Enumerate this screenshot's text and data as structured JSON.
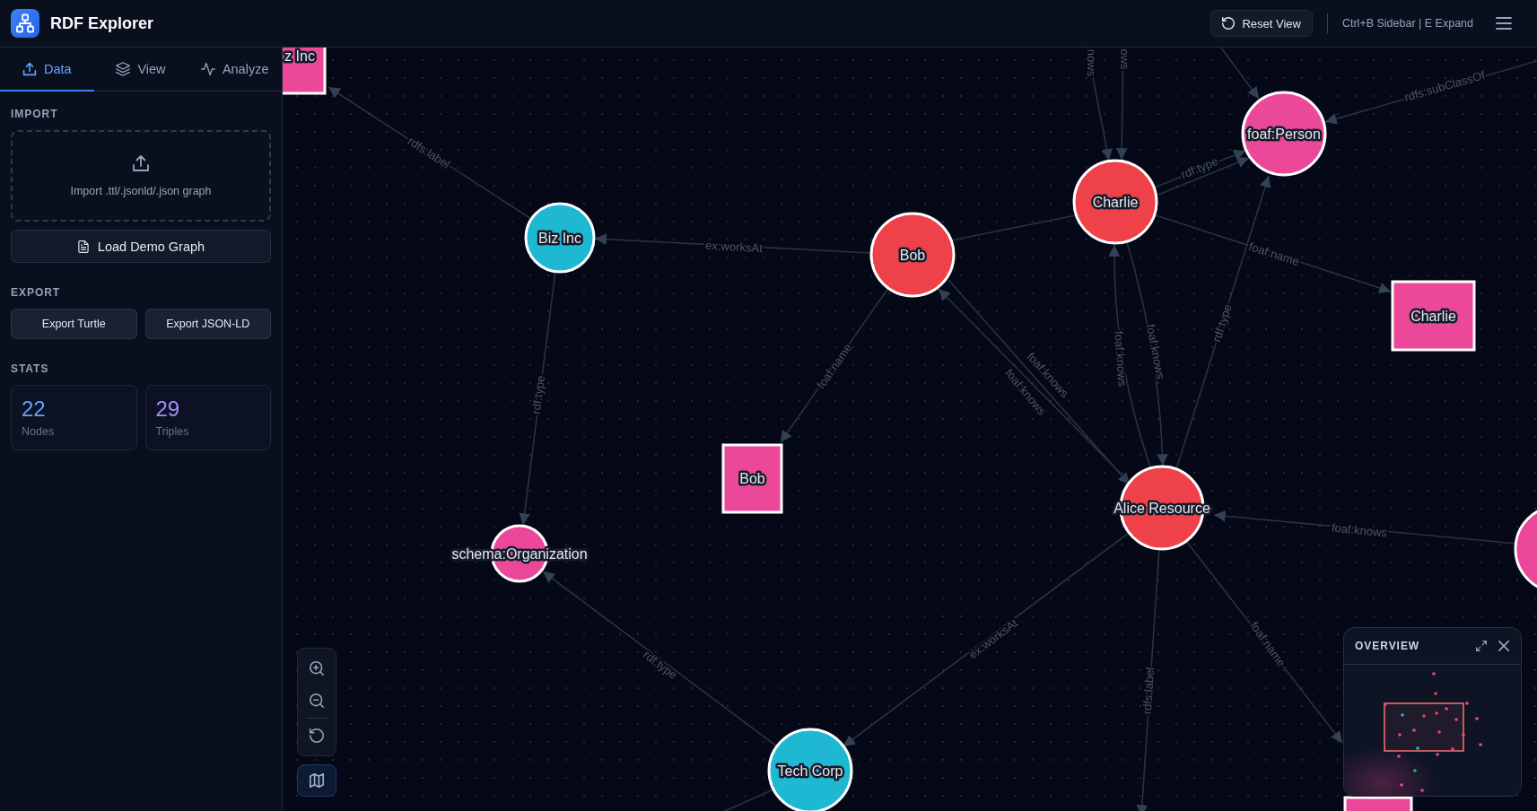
{
  "header": {
    "title": "RDF Explorer",
    "reset_button": "Reset View",
    "shortcut_hint": "Ctrl+B Sidebar | E Expand"
  },
  "sidebar": {
    "tabs": [
      {
        "label": "Data",
        "selected": true
      },
      {
        "label": "View",
        "selected": false
      },
      {
        "label": "Analyze",
        "selected": false
      }
    ],
    "import": {
      "heading": "IMPORT",
      "dropzone_text": "Import .ttl/.jsonld/.json graph",
      "demo_button": "Load Demo Graph"
    },
    "export": {
      "heading": "EXPORT",
      "buttons": [
        "Export Turtle",
        "Export JSON-LD"
      ]
    },
    "stats": {
      "heading": "STATS",
      "items": [
        {
          "value": "22",
          "label": "Nodes",
          "color": "#60a5fa"
        },
        {
          "value": "29",
          "label": "Triples",
          "color": "#a78bfa"
        }
      ]
    }
  },
  "graph": {
    "nodes": [
      {
        "kind": "literal",
        "label": "z Inc",
        "color": "#ec4899"
      },
      {
        "kind": "resource",
        "label": "Biz Inc",
        "color": "#1eb8d3"
      },
      {
        "kind": "resource",
        "label": "Bob",
        "color": "#ef4149"
      },
      {
        "kind": "resource",
        "label": "Charlie",
        "color": "#ef4149"
      },
      {
        "kind": "resource",
        "label": "foaf:Person",
        "color": "#ec4899"
      },
      {
        "kind": "literal",
        "label": "Charlie",
        "color": "#ec4899"
      },
      {
        "kind": "literal",
        "label": "Bob",
        "color": "#ec4899"
      },
      {
        "kind": "resource",
        "label": "schema:Organization",
        "color": "#ec4899"
      },
      {
        "kind": "resource",
        "label": "Alice Resource",
        "color": "#ef4149"
      },
      {
        "kind": "resource",
        "color": "#ec4899"
      },
      {
        "kind": "resource",
        "label": "Tech Corp",
        "color": "#1eb8d3"
      },
      {
        "kind": "literal",
        "color": "#ec4899"
      }
    ],
    "edges": [
      {
        "label": "rdfs:label"
      },
      {
        "label": "ex:worksAt"
      },
      {
        "label": "rdf:type"
      },
      {
        "label": "foaf:name"
      },
      {
        "label": "rdf:type"
      },
      {
        "label": "rdfs:subClassOf"
      },
      {
        "label": "foaf:name"
      },
      {
        "label": "foaf:knows"
      },
      {
        "label": "foaf:knows"
      },
      {
        "label": "rdf:type"
      },
      {
        "label": "foaf:knows"
      },
      {
        "label": "foaf:knows"
      },
      {
        "label": "foaf:knows"
      },
      {
        "label": "ex:worksAt"
      },
      {
        "label": "rdfs:label"
      },
      {
        "label": "foaf:name"
      },
      {
        "label": "rdf:type"
      },
      {
        "label": "nows"
      },
      {
        "label": "ows"
      }
    ]
  },
  "map_toggle": {
    "on": true
  },
  "overview": {
    "title": "OVERVIEW"
  }
}
